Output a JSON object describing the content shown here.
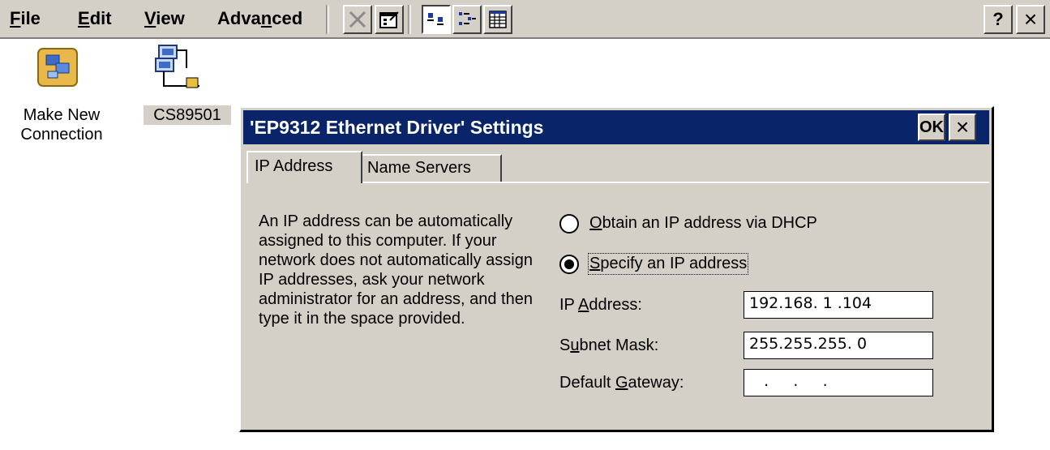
{
  "menu": {
    "file": {
      "mnemonic": "F",
      "rest": "ile"
    },
    "edit": {
      "mnemonic": "E",
      "rest": "dit"
    },
    "view": {
      "mnemonic": "V",
      "rest": "iew"
    },
    "advanced": {
      "before": "Adva",
      "mnemonic": "n",
      "after": "ced"
    }
  },
  "toolbar": {
    "buttons": [
      "delete-icon",
      "properties-icon",
      "large-icons-view-icon",
      "small-icons-view-icon",
      "details-view-icon"
    ],
    "help_label": "?",
    "close_label": "×"
  },
  "desktop": {
    "icons": [
      {
        "line1": "Make New",
        "line2": "Connection"
      },
      {
        "label": "CS89501",
        "selected": true
      }
    ]
  },
  "dialog": {
    "title": "'EP9312 Ethernet Driver' Settings",
    "ok_label": "OK",
    "close_label": "×",
    "tabs": [
      "IP Address",
      "Name Servers"
    ],
    "description": "An IP address can be automatically assigned to this computer.  If your network does not automatically assign IP addresses, ask your network administrator for an address, and then type it in the space provided.",
    "radios": {
      "dhcp": {
        "mnemonic": "O",
        "rest": "btain an IP address via DHCP",
        "checked": false
      },
      "specify": {
        "mnemonic": "S",
        "rest": "pecify an IP address",
        "checked": true
      }
    },
    "fields": {
      "ip": {
        "label_before": "IP ",
        "mnemonic": "A",
        "label_after": "ddress:",
        "value": "192.168. 1 .104"
      },
      "subnet": {
        "label_before": "S",
        "mnemonic": "u",
        "label_after": "bnet Mask:",
        "value": "255.255.255. 0"
      },
      "gateway": {
        "label_before": "Default ",
        "mnemonic": "G",
        "label_after": "ateway:",
        "value": "   .     .     ."
      }
    }
  },
  "colors": {
    "titlebar": "#0a246a",
    "chrome": "#d4d0c8",
    "selection": "#d4d0c8"
  }
}
